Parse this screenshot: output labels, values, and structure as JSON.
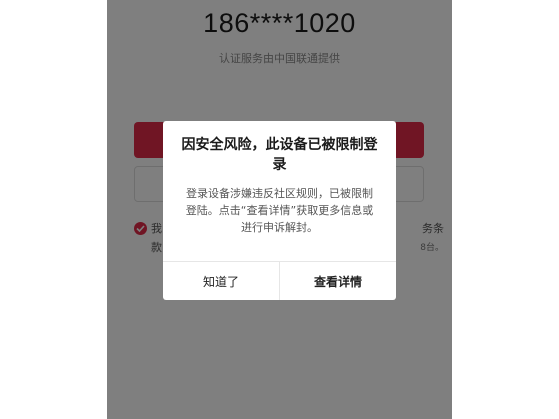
{
  "login_screen": {
    "phone_number": "186****1020",
    "auth_note": "认证服务由中国联通提供",
    "agreement_prefix": "我",
    "agreement_line2_prefix": "款",
    "agreement_suffix": "务条",
    "agreement_suffix2": "8台。"
  },
  "dialog": {
    "title": "因安全风险，此设备已被限制登录",
    "message": "登录设备涉嫌违反社区规则，已被限制登陆。点击“查看详情”获取更多信息或进行申诉解封。",
    "cancel_label": "知道了",
    "details_label": "查看详情"
  },
  "colors": {
    "accent": "#e02a48",
    "overlay": "rgba(0,0,0,0.5)"
  }
}
